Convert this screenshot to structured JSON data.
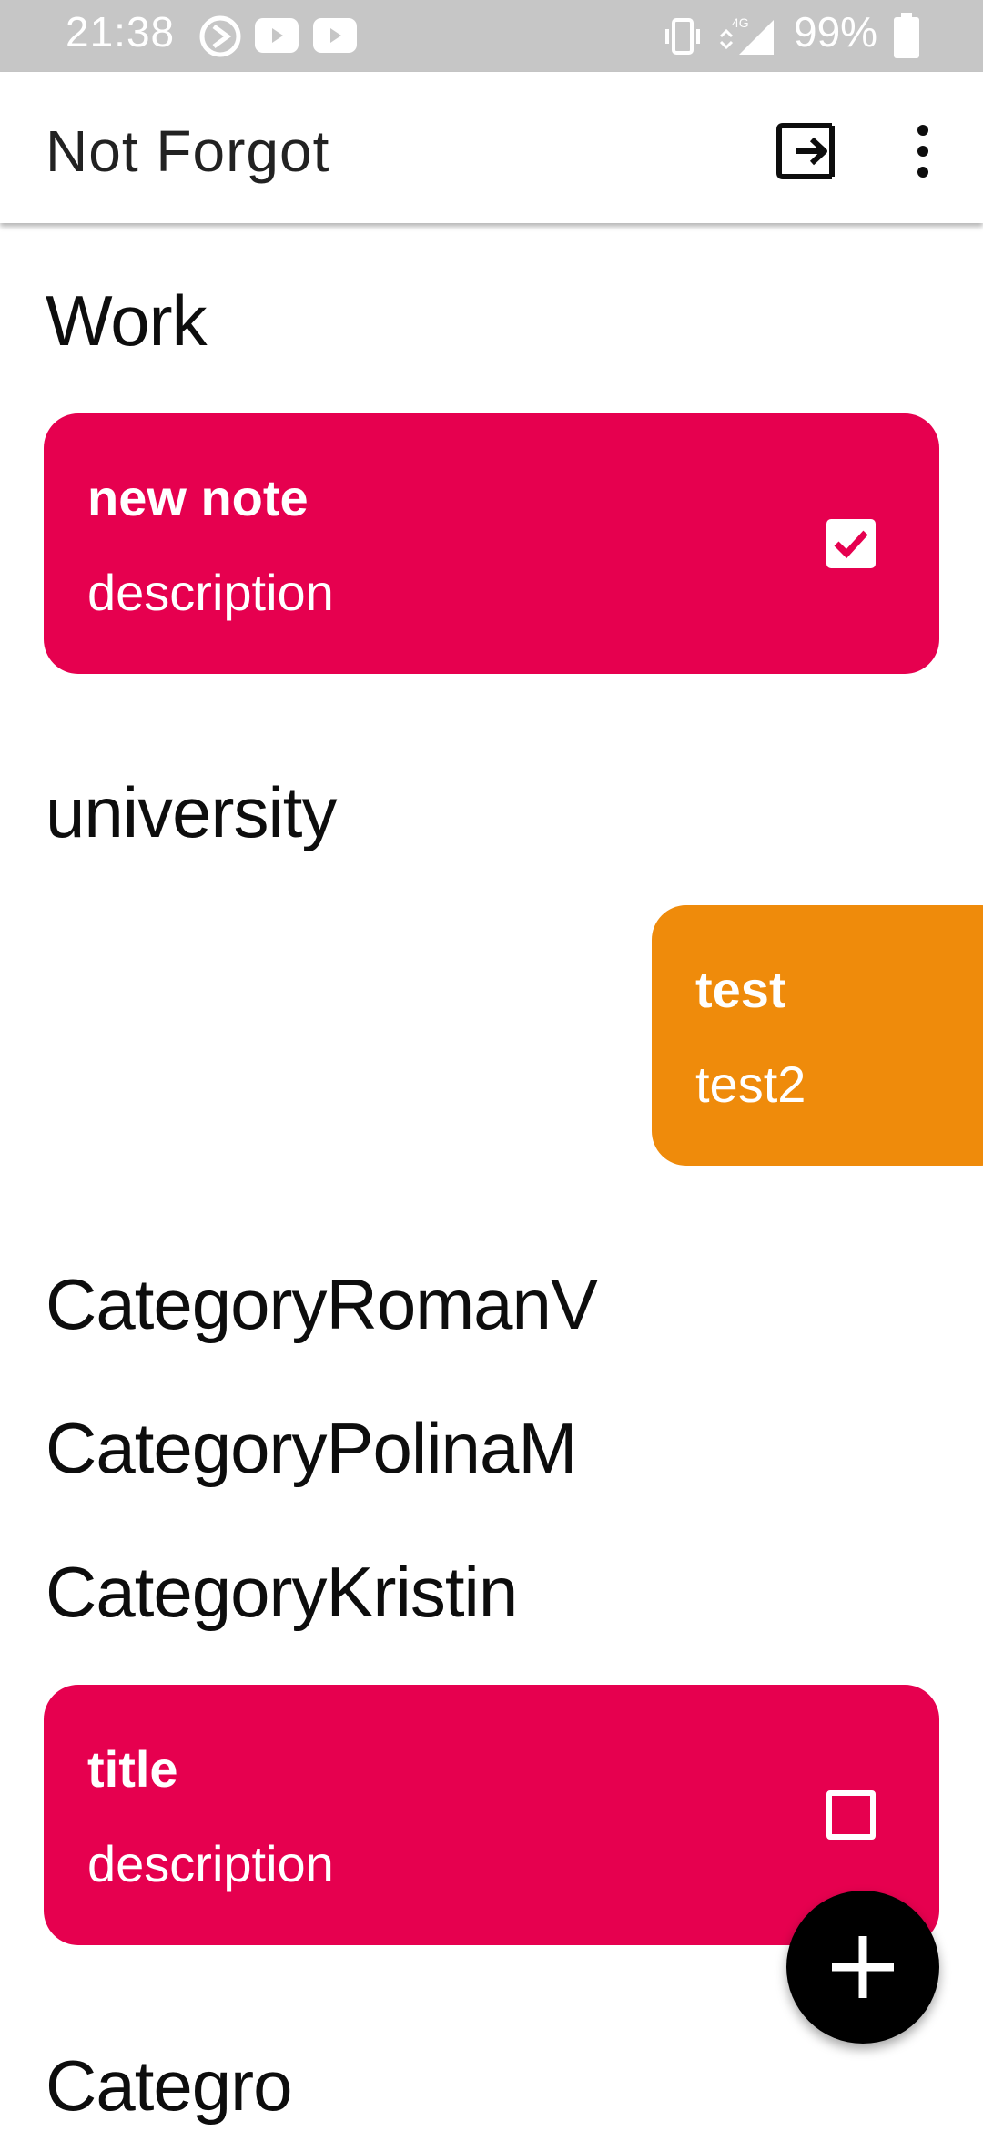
{
  "status_bar": {
    "time": "21:38",
    "battery_percent": "99%",
    "network": "4G",
    "icons": [
      "sync-icon",
      "youtube-icon",
      "youtube-icon",
      "vibrate-icon",
      "signal-icon",
      "battery-icon"
    ]
  },
  "app_bar": {
    "title": "Not Forgot",
    "actions": [
      "logout-icon",
      "more-vert-icon"
    ]
  },
  "categories": [
    {
      "name": "Work"
    },
    {
      "name": "university"
    },
    {
      "name": "CategoryRomanV"
    },
    {
      "name": "CategoryPolinaM"
    },
    {
      "name": "CategoryKristin"
    },
    {
      "name": "Categro"
    }
  ],
  "notes": [
    {
      "category": "Work",
      "title": "new note",
      "description": "description",
      "color": "#e6004f",
      "checked": true
    },
    {
      "category": "university",
      "title": "test",
      "description": "test2",
      "color": "#ef8b0b",
      "checked": false
    },
    {
      "category": "CategoryKristin",
      "title": "title",
      "description": "description",
      "color": "#e6004f",
      "checked": false
    }
  ],
  "fab": {
    "icon": "plus-icon"
  },
  "colors": {
    "status_bar": "#c6c6c6",
    "accent_red": "#e6004f",
    "accent_orange": "#ef8b0b",
    "fab": "#000000"
  }
}
